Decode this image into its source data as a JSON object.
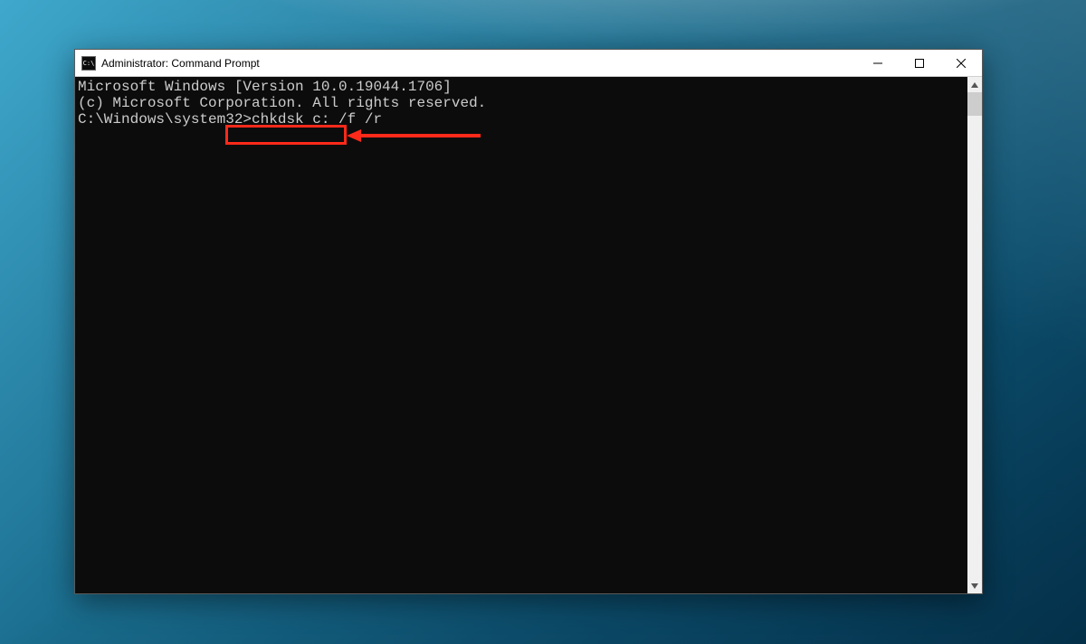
{
  "window": {
    "title": "Administrator: Command Prompt",
    "icon_label": "C:\\"
  },
  "console": {
    "line1": "Microsoft Windows [Version 10.0.19044.1706]",
    "line2": "(c) Microsoft Corporation. All rights reserved.",
    "blank": "",
    "prompt": "C:\\Windows\\system32>",
    "command": "chkdsk c: /f /r"
  },
  "colors": {
    "highlight": "#ff2a1a",
    "console_bg": "#0c0c0c",
    "console_fg": "#cccccc"
  }
}
